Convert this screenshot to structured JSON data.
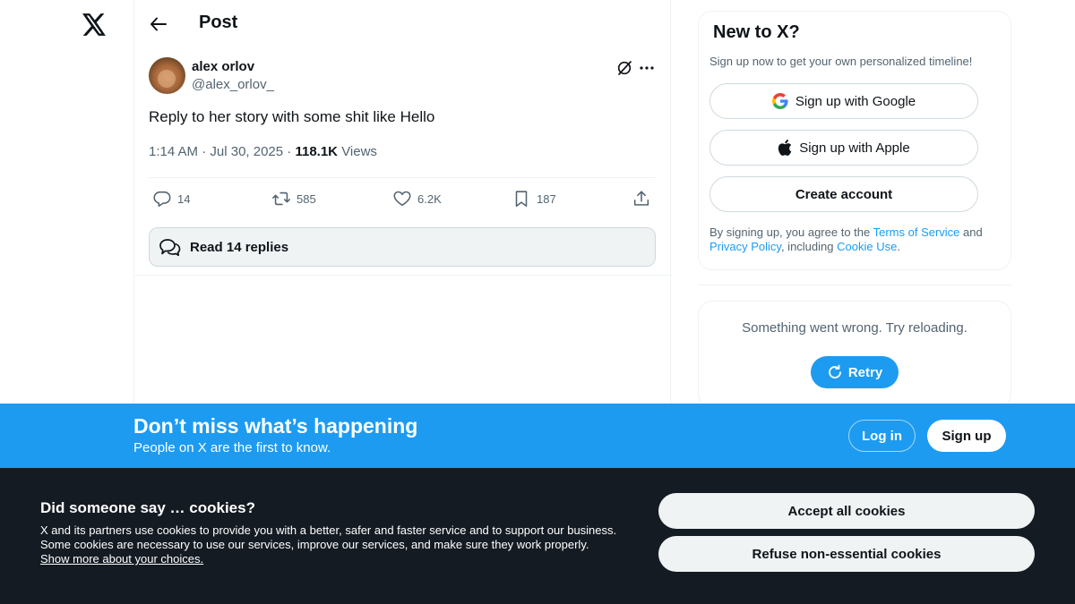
{
  "nav": {
    "logo_icon": "x-logo-icon"
  },
  "header": {
    "title": "Post",
    "back_icon": "arrow-left-icon"
  },
  "tweet": {
    "author_name": "alex orlov",
    "author_handle": "@alex_orlov_",
    "text": "Reply to her story with some shit like Hello",
    "time": "1:14 AM",
    "date": "Jul 30, 2025",
    "views": "118.1K",
    "views_label": "Views",
    "sep": "·",
    "replies": "14",
    "reposts": "585",
    "likes": "6.2K",
    "bookmarks": "187",
    "read_replies": "Read 14 replies"
  },
  "sidebar": {
    "signup_title": "New to X?",
    "signup_sub": "Sign up now to get your own personalized timeline!",
    "google": "Sign up with Google",
    "apple": "Sign up with Apple",
    "create": "Create account",
    "terms_pre": "By signing up, you agree to the ",
    "terms_link": "Terms of Service",
    "terms_and": " and",
    "privacy_link": "Privacy Policy",
    "including": ", including ",
    "cookie_link": "Cookie Use",
    "period": ".",
    "error_text": "Something went wrong. Try reloading.",
    "retry": "Retry"
  },
  "banner": {
    "title": "Don’t miss what’s happening",
    "sub": "People on X are the first to know.",
    "login": "Log in",
    "signup": "Sign up"
  },
  "cookies": {
    "title": "Did someone say … cookies?",
    "text": "X and its partners use cookies to provide you with a better, safer and faster service and to support our business. Some cookies are necessary to use our services, improve our services, and make sure they work properly.",
    "link": "Show more about your choices.",
    "accept": "Accept all cookies",
    "refuse": "Refuse non-essential cookies"
  },
  "colors": {
    "accent": "#1d9bf0",
    "text": "#0f1419",
    "muted": "#536471",
    "dark": "#141b23"
  }
}
